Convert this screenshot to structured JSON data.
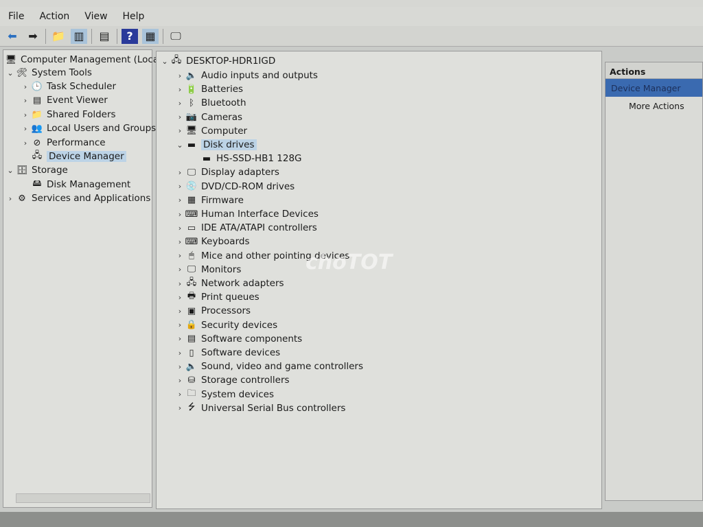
{
  "menu": [
    "File",
    "Action",
    "View",
    "Help"
  ],
  "toolbar": [
    {
      "icon": "back-arrow-icon",
      "glyph": "⬅",
      "color": "#2a6fc0"
    },
    {
      "icon": "forward-arrow-icon",
      "glyph": "➡",
      "color": "#222"
    },
    {
      "icon": "up-folder-icon",
      "glyph": "📁"
    },
    {
      "icon": "show-hide-console-tree-icon",
      "glyph": "▥",
      "active": true
    },
    {
      "icon": "properties-icon",
      "glyph": "▤"
    },
    {
      "icon": "help-icon",
      "glyph": "?"
    },
    {
      "icon": "show-hide-action-pane-icon",
      "glyph": "▦",
      "active": true
    },
    {
      "icon": "monitor-icon",
      "glyph": "🖵"
    }
  ],
  "left_tree": [
    {
      "label": "Computer Management (Local",
      "icon": "computer-management-icon",
      "glyph": "🖥",
      "level": 0,
      "arrow": ""
    },
    {
      "label": "System Tools",
      "icon": "tools-icon",
      "glyph": "🛠",
      "level": 0,
      "arrow": "⌄"
    },
    {
      "label": "Task Scheduler",
      "icon": "clock-icon",
      "glyph": "🕒",
      "level": 1,
      "arrow": "›"
    },
    {
      "label": "Event Viewer",
      "icon": "event-viewer-icon",
      "glyph": "▤",
      "level": 1,
      "arrow": "›"
    },
    {
      "label": "Shared Folders",
      "icon": "shared-folder-icon",
      "glyph": "📁",
      "level": 1,
      "arrow": "›"
    },
    {
      "label": "Local Users and Groups",
      "icon": "users-icon",
      "glyph": "👥",
      "level": 1,
      "arrow": "›"
    },
    {
      "label": "Performance",
      "icon": "performance-icon",
      "glyph": "⊘",
      "level": 1,
      "arrow": "›"
    },
    {
      "label": "Device Manager",
      "icon": "device-manager-icon",
      "glyph": "🖧",
      "level": 1,
      "arrow": "",
      "selected": true
    },
    {
      "label": "Storage",
      "icon": "storage-icon",
      "glyph": "🗄",
      "level": 0,
      "arrow": "⌄"
    },
    {
      "label": "Disk Management",
      "icon": "disk-management-icon",
      "glyph": "🖴",
      "level": 1,
      "arrow": ""
    },
    {
      "label": "Services and Applications",
      "icon": "services-icon",
      "glyph": "⚙",
      "level": 0,
      "arrow": "›"
    }
  ],
  "device_tree": {
    "root": "DESKTOP-HDR1IGD",
    "items": [
      {
        "label": "Audio inputs and outputs",
        "icon": "speaker-icon",
        "glyph": "🔈"
      },
      {
        "label": "Batteries",
        "icon": "battery-icon",
        "glyph": "🔋"
      },
      {
        "label": "Bluetooth",
        "icon": "bluetooth-icon",
        "glyph": "ᛒ"
      },
      {
        "label": "Cameras",
        "icon": "camera-icon",
        "glyph": "📷"
      },
      {
        "label": "Computer",
        "icon": "computer-icon",
        "glyph": "🖥"
      },
      {
        "label": "Disk drives",
        "icon": "disk-drive-icon",
        "glyph": "▬",
        "expanded": true,
        "selected": true,
        "children": [
          "HS-SSD-HB1 128G"
        ]
      },
      {
        "label": "Display adapters",
        "icon": "display-adapter-icon",
        "glyph": "🖵"
      },
      {
        "label": "DVD/CD-ROM drives",
        "icon": "dvd-icon",
        "glyph": "💿"
      },
      {
        "label": "Firmware",
        "icon": "firmware-icon",
        "glyph": "▦"
      },
      {
        "label": "Human Interface Devices",
        "icon": "hid-icon",
        "glyph": "⌨"
      },
      {
        "label": "IDE ATA/ATAPI controllers",
        "icon": "ide-controller-icon",
        "glyph": "▭"
      },
      {
        "label": "Keyboards",
        "icon": "keyboard-icon",
        "glyph": "⌨"
      },
      {
        "label": "Mice and other pointing devices",
        "icon": "mouse-icon",
        "glyph": "🖱"
      },
      {
        "label": "Monitors",
        "icon": "monitor-icon",
        "glyph": "🖵"
      },
      {
        "label": "Network adapters",
        "icon": "network-adapter-icon",
        "glyph": "🖧"
      },
      {
        "label": "Print queues",
        "icon": "printer-icon",
        "glyph": "🖶"
      },
      {
        "label": "Processors",
        "icon": "processor-icon",
        "glyph": "▣"
      },
      {
        "label": "Security devices",
        "icon": "security-device-icon",
        "glyph": "🔒"
      },
      {
        "label": "Software components",
        "icon": "software-component-icon",
        "glyph": "▤"
      },
      {
        "label": "Software devices",
        "icon": "software-device-icon",
        "glyph": "▯"
      },
      {
        "label": "Sound, video and game controllers",
        "icon": "sound-icon",
        "glyph": "🔈"
      },
      {
        "label": "Storage controllers",
        "icon": "storage-controller-icon",
        "glyph": "⛁"
      },
      {
        "label": "System devices",
        "icon": "system-device-icon",
        "glyph": "🗀"
      },
      {
        "label": "Universal Serial Bus controllers",
        "icon": "usb-icon",
        "glyph": "⭍"
      }
    ]
  },
  "actions": {
    "header": "Actions",
    "section": "Device Manager",
    "items": [
      "More Actions"
    ]
  },
  "watermark": "choTOT"
}
